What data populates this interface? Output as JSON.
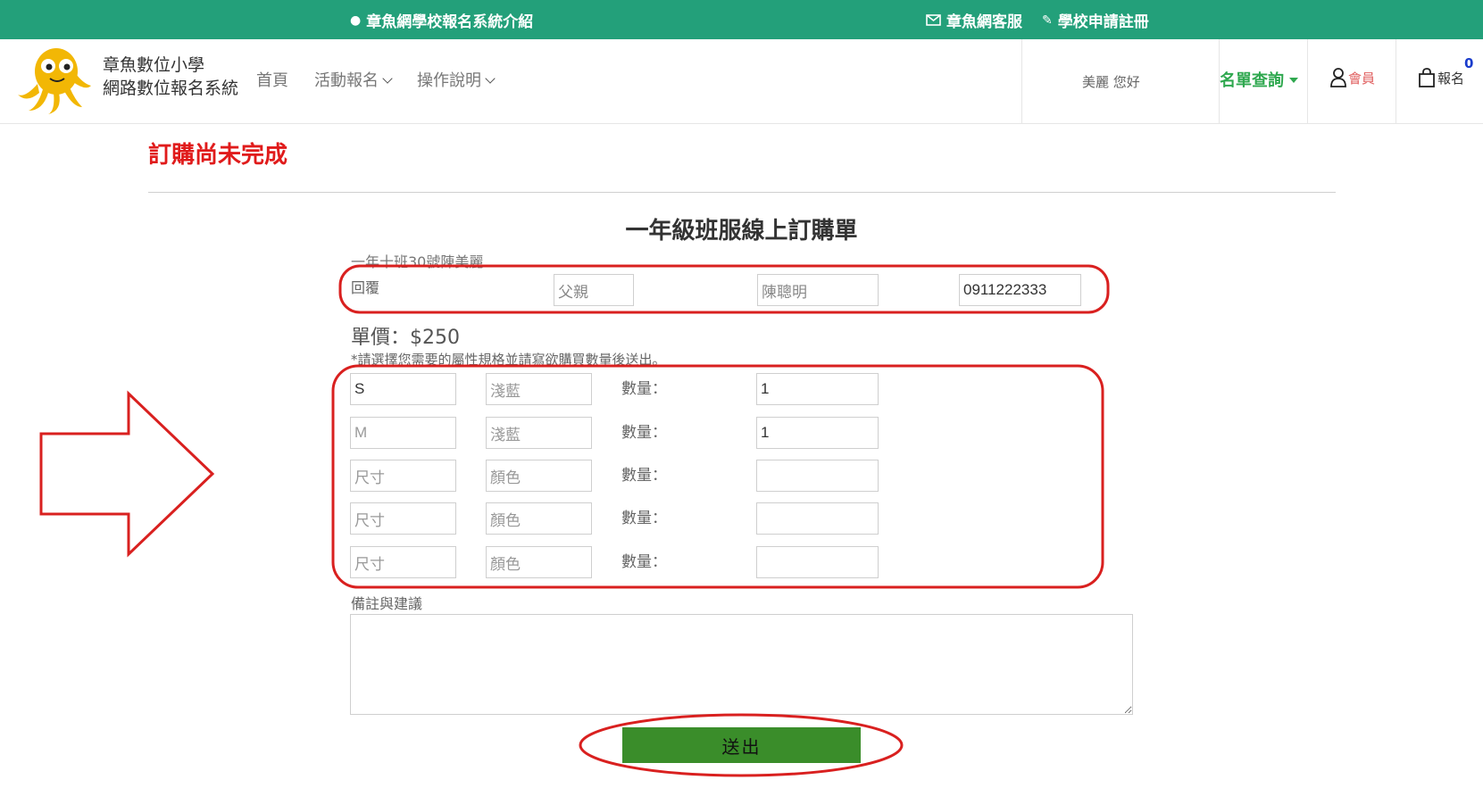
{
  "topbar": {
    "intro_link": "章魚網學校報名系統介紹",
    "service_link": "章魚網客服",
    "register_link": "學校申請註冊",
    "bg_color": "#23a07a"
  },
  "header": {
    "brand_line1": "章魚數位小學",
    "brand_line2": "網路數位報名系統",
    "nav": [
      "首頁",
      "活動報名",
      "操作說明"
    ],
    "greeting": "美麗 您好",
    "query_label": "名單查詢",
    "member_label": "會員",
    "cart_label": "報名",
    "cart_count": "0"
  },
  "content": {
    "order_status": "訂購尚未完成",
    "form_title": "一年級班服線上訂購單",
    "class_line": "一年十班30號陳美麗",
    "reply_label": "回覆",
    "reply_relation": "父親",
    "reply_name": "陳聰明",
    "reply_phone": "0911222333",
    "price": "單價：$250",
    "instruction": "*請選擇您需要的屬性規格並請寫欲購買數量後送出。",
    "qty_label": "數量：",
    "items": [
      {
        "size": "S",
        "color": "淺藍",
        "qty": "1"
      },
      {
        "size": "M",
        "color": "淺藍",
        "qty": "1"
      },
      {
        "size": "尺寸",
        "color": "顏色",
        "qty": ""
      },
      {
        "size": "尺寸",
        "color": "顏色",
        "qty": ""
      },
      {
        "size": "尺寸",
        "color": "顏色",
        "qty": ""
      }
    ],
    "remarks_label": "備註與建議",
    "remarks_value": "",
    "submit_label": "送出"
  },
  "annotation_color": "#d9201f",
  "submit_color": "#3a8d2a",
  "status_color": "#e01b1b"
}
